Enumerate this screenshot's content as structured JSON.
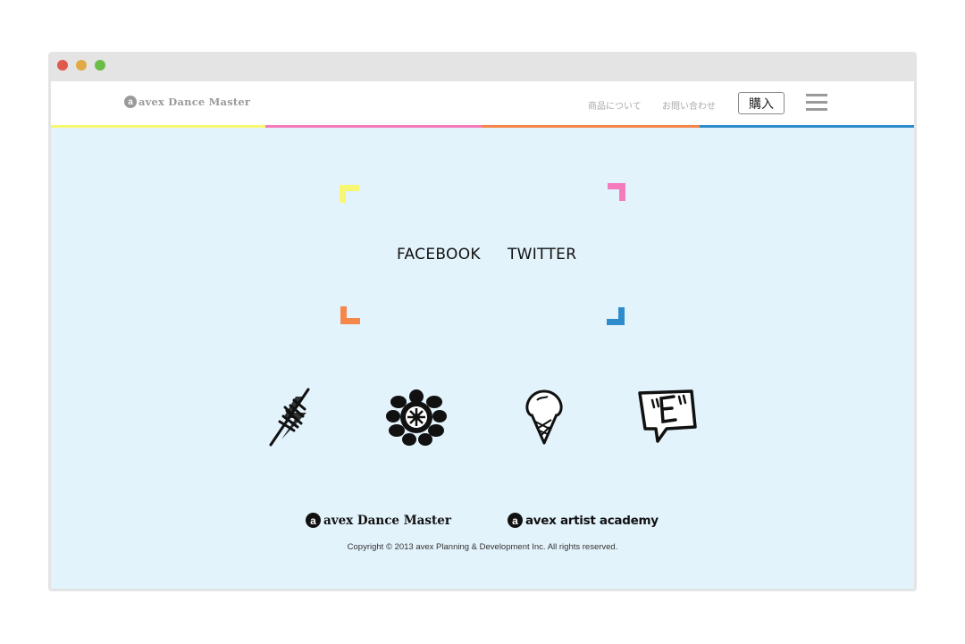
{
  "window": {
    "controls": [
      "close",
      "minimize",
      "maximize"
    ],
    "control_colors": {
      "close": "#e0594f",
      "minimize": "#e2aa47",
      "maximize": "#6bbd48"
    }
  },
  "header": {
    "logo_mark": "a",
    "logo_text": "avex Dance Master",
    "nav": {
      "products": "商品について",
      "contact": "お問い合わせ"
    },
    "buy_label": "購入",
    "menu_icon": "hamburger-icon",
    "stripe_colors": [
      "#f7f772",
      "#f57bbd",
      "#f5874a",
      "#2f8ccc"
    ]
  },
  "social": {
    "facebook_label": "FACEBOOK",
    "twitter_label": "TWITTER",
    "corner_colors": {
      "top_left": "#f7f772",
      "top_right": "#f57bbd",
      "bottom_left": "#f5874a",
      "bottom_right": "#2f8ccc"
    }
  },
  "icons": [
    "lightning-icon",
    "palm-tree-icon",
    "ice-cream-icon",
    "speech-bubble-e-icon"
  ],
  "footer": {
    "logos": [
      {
        "mark": "a",
        "text": "avex Dance Master"
      },
      {
        "mark": "a",
        "text": "avex artist academy"
      }
    ],
    "copyright": "Copyright © 2013   avex Planning & Development Inc. All rights reserved."
  },
  "colors": {
    "background": "#e3f3fb",
    "header_bg": "#ffffff",
    "text": "#111111"
  }
}
